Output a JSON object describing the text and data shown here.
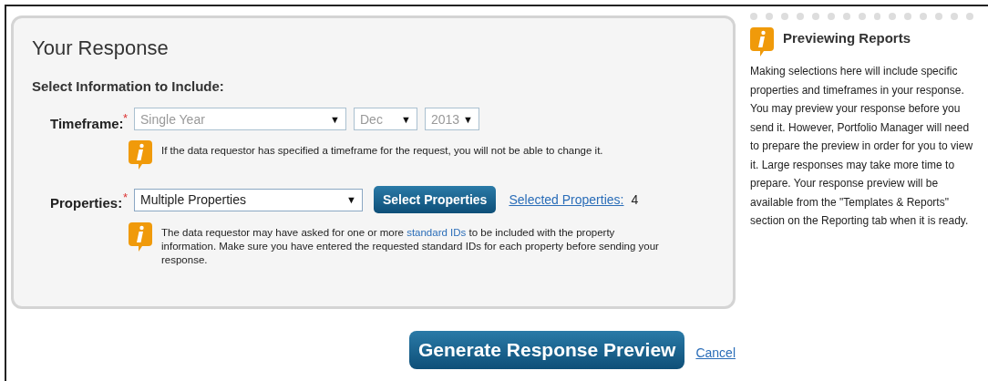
{
  "response": {
    "title": "Your Response",
    "section_heading": "Select Information to Include:",
    "timeframe": {
      "label": "Timeframe:",
      "required_mark": "*",
      "disabled": true,
      "selects": [
        {
          "value": "Single Year",
          "arrow": "▼"
        },
        {
          "value": "Dec",
          "arrow": "▼"
        },
        {
          "value": "2013",
          "arrow": "▼"
        }
      ],
      "note": {
        "before": "If the data requestor has specified a timeframe for the request, you will not be able to change it."
      }
    },
    "properties": {
      "label": "Properties:",
      "required_mark": "*",
      "disabled": false,
      "select": {
        "value": "Multiple Properties",
        "arrow": "▼"
      },
      "button": "Select Properties",
      "selected_link": "Selected Properties:",
      "selected_count": "4",
      "note": {
        "before": "The data requestor may have asked for one or more",
        "link": "standard IDs",
        "after": "to be included with the property information. Make sure you have entered the requested standard IDs for each property before sending your response."
      }
    }
  },
  "actions": {
    "primary": "Generate Response Preview",
    "cancel": "Cancel"
  },
  "sidebar": {
    "title": "Previewing Reports",
    "body": "Making selections here will include specific properties and timeframes in your response. You may preview your response before you send it. However, Portfolio Manager will need to prepare the preview in order for you to view it. Large responses may take more time to prepare. Your response preview will be available from the \"Templates & Reports\" section on the Reporting tab when it is ready."
  }
}
